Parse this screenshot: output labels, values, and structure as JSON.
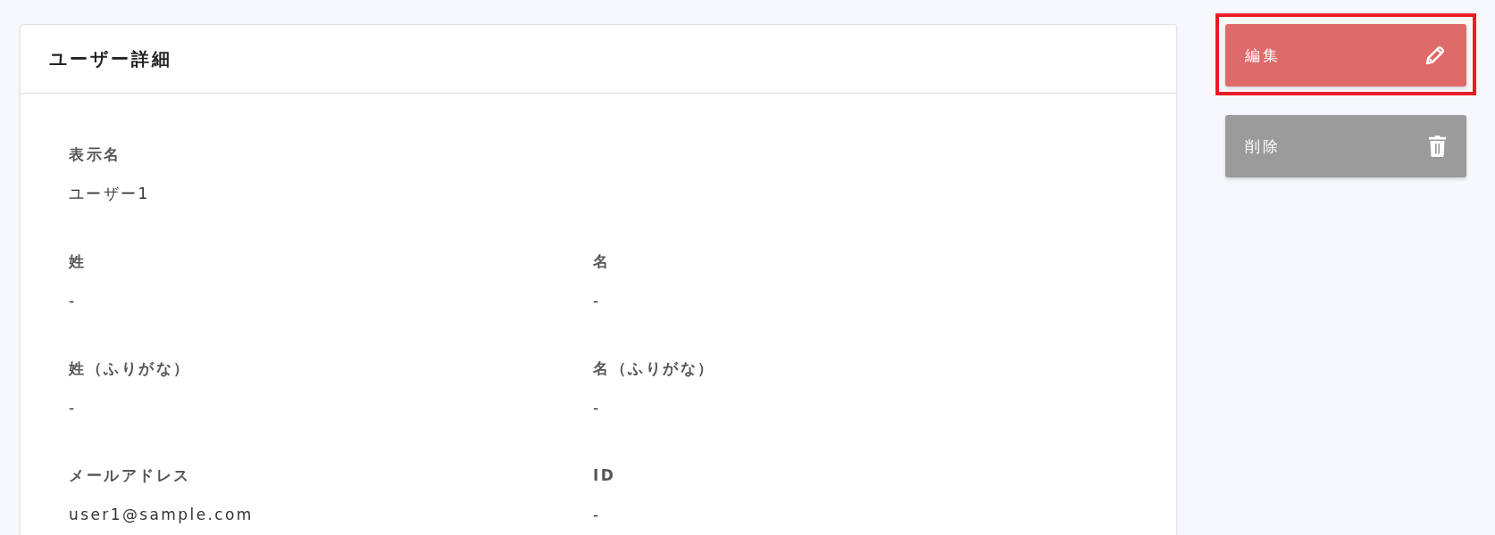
{
  "card": {
    "title": "ユーザー詳細"
  },
  "rows": [
    {
      "fields": [
        {
          "label": "表示名",
          "value": "ユーザー1"
        }
      ]
    },
    {
      "fields": [
        {
          "label": "姓",
          "value": "-"
        },
        {
          "label": "名",
          "value": "-"
        }
      ]
    },
    {
      "fields": [
        {
          "label": "姓（ふりがな）",
          "value": "-"
        },
        {
          "label": "名（ふりがな）",
          "value": "-"
        }
      ]
    },
    {
      "fields": [
        {
          "label": "メールアドレス",
          "value": "user1@sample.com"
        },
        {
          "label": "ID",
          "value": "-"
        }
      ]
    }
  ],
  "buttons": [
    {
      "label": "編集",
      "kind": "edit",
      "highlighted": true
    },
    {
      "label": "削除",
      "kind": "delete",
      "highlighted": false
    }
  ]
}
